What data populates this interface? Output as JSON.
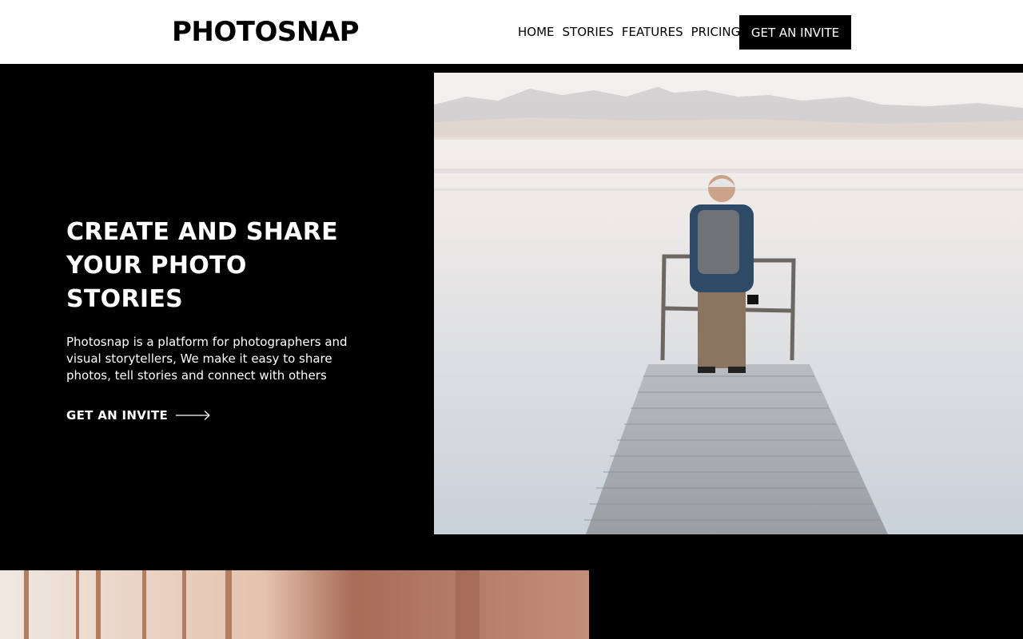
{
  "header": {
    "logo": "PHOTOSNAP",
    "nav": [
      {
        "label": "HOME"
      },
      {
        "label": "STORIES"
      },
      {
        "label": "FEATURES"
      },
      {
        "label": "PRICING"
      }
    ],
    "cta_label": "GET AN INVITE"
  },
  "hero": {
    "title_line1": "CREATE AND SHARE",
    "title_line2": "YOUR PHOTO STORIES",
    "description": "Photosnap is a platform for photographers and visual storytellers, We make it easy to share photos, tell stories and connect with others",
    "cta_label": "GET AN INVITE",
    "cta_icon": "arrow-right-icon"
  },
  "colors": {
    "background": "#000000",
    "header_bg": "#ffffff",
    "text_dark": "#000000",
    "text_light": "#ffffff"
  }
}
